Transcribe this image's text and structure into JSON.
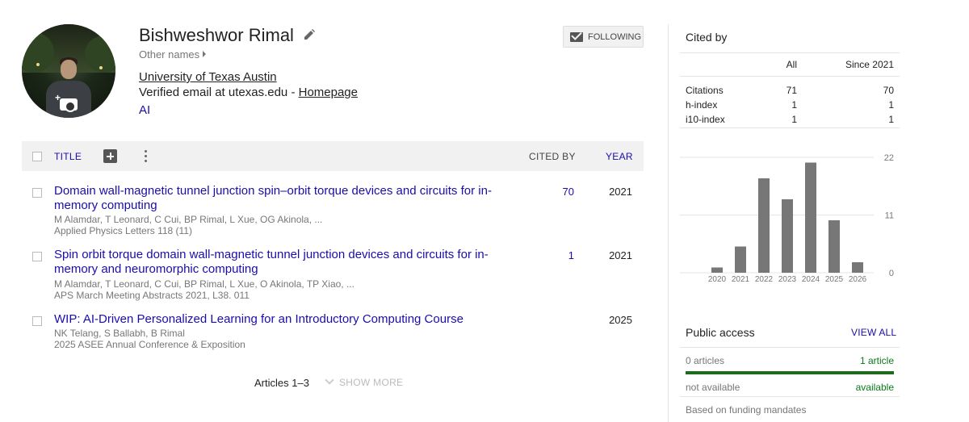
{
  "profile": {
    "name": "Bishweshwor Rimal",
    "other_names_label": "Other names",
    "affiliation": "University of Texas Austin",
    "email_text": "Verified email at utexas.edu - ",
    "homepage_label": "Homepage",
    "interest": "AI",
    "follow_label": "FOLLOWING"
  },
  "table": {
    "header": {
      "title": "TITLE",
      "cited_by": "CITED BY",
      "year": "YEAR"
    },
    "articles": [
      {
        "title": "Domain wall-magnetic tunnel junction spin–orbit torque devices and circuits for in-memory computing",
        "authors": "M Alamdar, T Leonard, C Cui, BP Rimal, L Xue, OG Akinola, ...",
        "venue": "Applied Physics Letters 118 (11)",
        "cited_by": "70",
        "year": "2021"
      },
      {
        "title": "Spin orbit torque domain wall-magnetic tunnel junction devices and circuits for in-memory and neuromorphic computing",
        "authors": "M Alamdar, T Leonard, C Cui, BP Rimal, L Xue, O Akinola, TP Xiao, ...",
        "venue": "APS March Meeting Abstracts 2021, L38. 011",
        "cited_by": "1",
        "year": "2021"
      },
      {
        "title": "WIP: AI-Driven Personalized Learning for an Introductory Computing Course",
        "authors": "NK Telang, S Ballabh, B Rimal",
        "venue": "2025 ASEE Annual Conference & Exposition",
        "cited_by": "",
        "year": "2025"
      }
    ],
    "articles_count": "Articles 1–3",
    "show_more": "SHOW MORE"
  },
  "cited_by": {
    "title": "Cited by",
    "col_all": "All",
    "col_since": "Since 2021",
    "rows": [
      {
        "label": "Citations",
        "all": "71",
        "since": "70"
      },
      {
        "label": "h-index",
        "all": "1",
        "since": "1"
      },
      {
        "label": "i10-index",
        "all": "1",
        "since": "1"
      }
    ]
  },
  "chart_data": {
    "type": "bar",
    "categories": [
      "2020",
      "2021",
      "2022",
      "2023",
      "2024",
      "2025",
      "2026"
    ],
    "values": [
      1,
      5,
      18,
      14,
      21,
      10,
      2
    ],
    "ylim": [
      0,
      22
    ],
    "yticks": [
      0,
      11,
      22
    ],
    "bar_color": "#777777"
  },
  "public_access": {
    "title": "Public access",
    "view_all": "VIEW ALL",
    "not_available_count": "0 articles",
    "available_count": "1 article",
    "not_available_label": "not available",
    "available_label": "available",
    "note": "Based on funding mandates"
  }
}
